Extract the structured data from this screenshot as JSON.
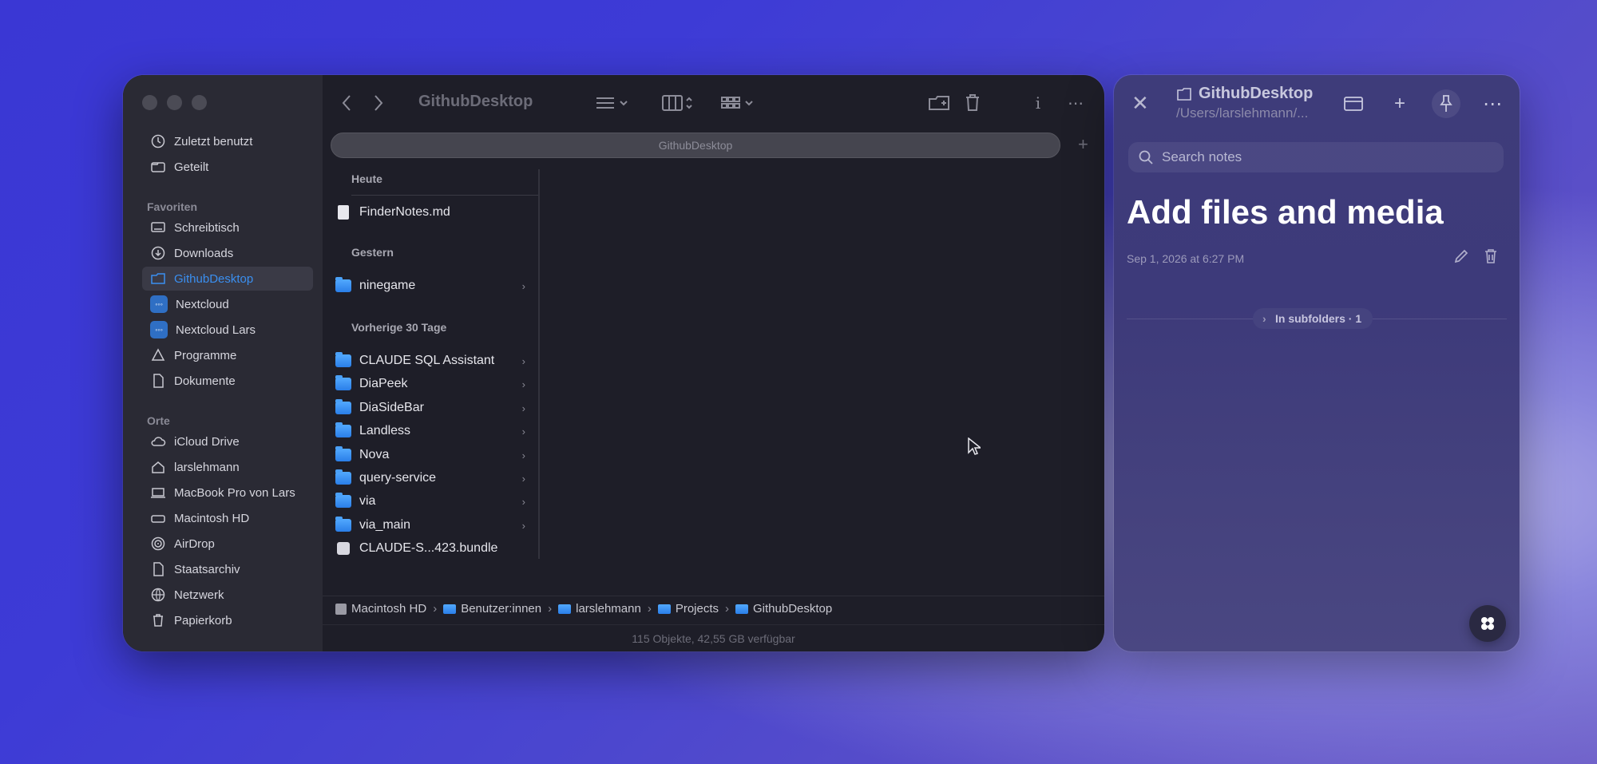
{
  "finder": {
    "window_title": "GithubDesktop",
    "path_tab": "GithubDesktop",
    "sidebar": {
      "top_items": [
        {
          "label": "Zuletzt benutzt",
          "icon": "clock-icon"
        },
        {
          "label": "Geteilt",
          "icon": "shared-folder-icon"
        }
      ],
      "favorites_title": "Favoriten",
      "favorites": [
        {
          "label": "Schreibtisch",
          "icon": "desktop-icon"
        },
        {
          "label": "Downloads",
          "icon": "download-icon"
        },
        {
          "label": "GithubDesktop",
          "icon": "folder-icon"
        },
        {
          "label": "Nextcloud",
          "icon": "nextcloud-icon"
        },
        {
          "label": "Nextcloud Lars",
          "icon": "nextcloud-icon"
        },
        {
          "label": "Programme",
          "icon": "apps-icon"
        },
        {
          "label": "Dokumente",
          "icon": "document-icon"
        }
      ],
      "places_title": "Orte",
      "places": [
        {
          "label": "iCloud Drive",
          "icon": "cloud-icon"
        },
        {
          "label": "larslehmann",
          "icon": "home-icon"
        },
        {
          "label": "MacBook Pro von Lars",
          "icon": "laptop-icon"
        },
        {
          "label": "Macintosh HD",
          "icon": "disk-icon"
        },
        {
          "label": "AirDrop",
          "icon": "airdrop-icon"
        },
        {
          "label": "Staatsarchiv",
          "icon": "document-icon"
        },
        {
          "label": "Netzwerk",
          "icon": "globe-icon"
        },
        {
          "label": "Papierkorb",
          "icon": "trash-icon"
        }
      ]
    },
    "groups": {
      "today": "Heute",
      "yesterday": "Gestern",
      "last30": "Vorherige 30 Tage"
    },
    "today_items": [
      "FinderNotes.md"
    ],
    "yesterday_items": [
      "ninegame"
    ],
    "last30_items": [
      "CLAUDE SQL Assistant",
      "DiaPeek",
      "DiaSideBar",
      "Landless",
      "Nova",
      "query-service",
      "via",
      "via_main"
    ],
    "bundle_item": "CLAUDE-S...423.bundle",
    "breadcrumb": [
      "Macintosh HD",
      "Benutzer:innen",
      "larslehmann",
      "Projects",
      "GithubDesktop"
    ],
    "status": "115 Objekte, 42,55 GB verfügbar"
  },
  "notes": {
    "folder_title": "GithubDesktop",
    "folder_path": "/Users/larslehmann/...",
    "search_placeholder": "Search notes",
    "note_title": "Add files and media",
    "note_date": "Sep 1, 2026 at 6:27 PM",
    "subfolders_label": "In subfolders · 1"
  },
  "colors": {
    "accent": "#3a8ff0",
    "folder_blue": "#3f95f5"
  }
}
